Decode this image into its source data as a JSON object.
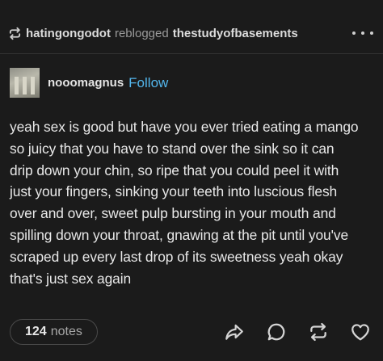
{
  "reblog_header": {
    "user": "hatingongodot",
    "verb": "reblogged",
    "source": "thestudyofbasements",
    "reblog_icon": "reblog-icon",
    "more_icon": "more-horizontal-icon"
  },
  "author": {
    "name": "nooomagnus",
    "follow_label": "Follow",
    "avatar_icon": "avatar-image"
  },
  "post": {
    "lines": [
      "yeah sex is good but have you ever tried eating a mango",
      "so juicy that you have to stand over the sink so it can",
      "drip down your chin, so ripe that you could peel it with",
      "just your fingers, sinking your teeth into luscious flesh",
      "over and over, sweet pulp bursting in your mouth and",
      "spilling down your throat, gnawing at the pit until you've",
      "scraped up every last drop of its sweetness yeah okay",
      "that's just sex again"
    ]
  },
  "footer": {
    "notes_count": "124",
    "notes_label": "notes",
    "actions": [
      "share-icon",
      "reply-icon",
      "reblog-icon",
      "like-heart-icon"
    ]
  },
  "colors": {
    "background": "#1b1b1b",
    "text": "#e8e8e8",
    "muted": "#9a9a9a",
    "accent": "#53b6ec"
  }
}
